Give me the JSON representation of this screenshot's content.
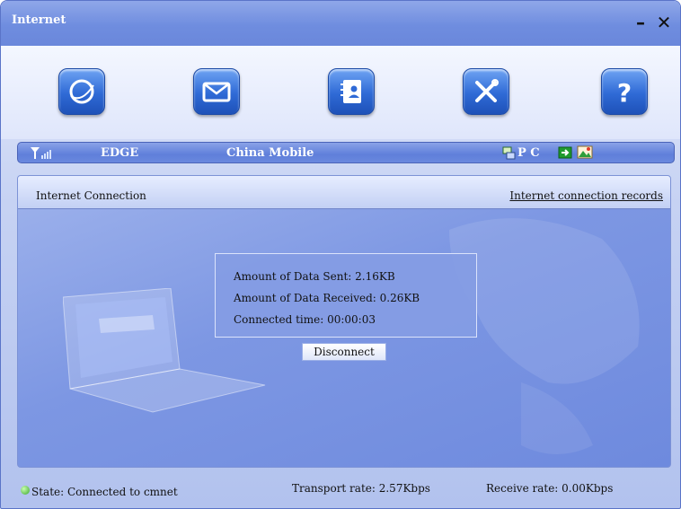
{
  "window": {
    "title": "Internet",
    "minimize_icon": "minimize-icon",
    "close_icon": "close-icon"
  },
  "toolbar": {
    "buttons": [
      {
        "name": "internet",
        "icon": "globe-icon"
      },
      {
        "name": "messages",
        "icon": "envelope-icon"
      },
      {
        "name": "contacts",
        "icon": "address-book-icon"
      },
      {
        "name": "settings",
        "icon": "tools-icon"
      },
      {
        "name": "help",
        "icon": "help-icon"
      }
    ]
  },
  "statusbar": {
    "signal_icon": "signal-strength-icon",
    "network_type": "EDGE",
    "carrier": "China Mobile",
    "pc_icon": "pc-connection-icon",
    "pc_label": "P C",
    "extra_icons": [
      "sim-card-icon",
      "picture-icon"
    ]
  },
  "panel": {
    "title": "Internet Connection",
    "records_link": "Internet connection records",
    "data_sent": "Amount of Data Sent: 2.16KB",
    "data_received": "Amount of Data Received: 0.26KB",
    "connected_time": "Connected time: 00:00:03",
    "disconnect_label": "Disconnect"
  },
  "bottombar": {
    "state": "State: Connected to cmnet",
    "transport_rate": "Transport rate: 2.57Kbps",
    "receive_rate": "Receive rate: 0.00Kbps"
  },
  "colors": {
    "accent": "#2f6ad6",
    "titlebar": "#6f8ddf",
    "panel": "#7d97e3",
    "connected": "#3aa52a"
  }
}
